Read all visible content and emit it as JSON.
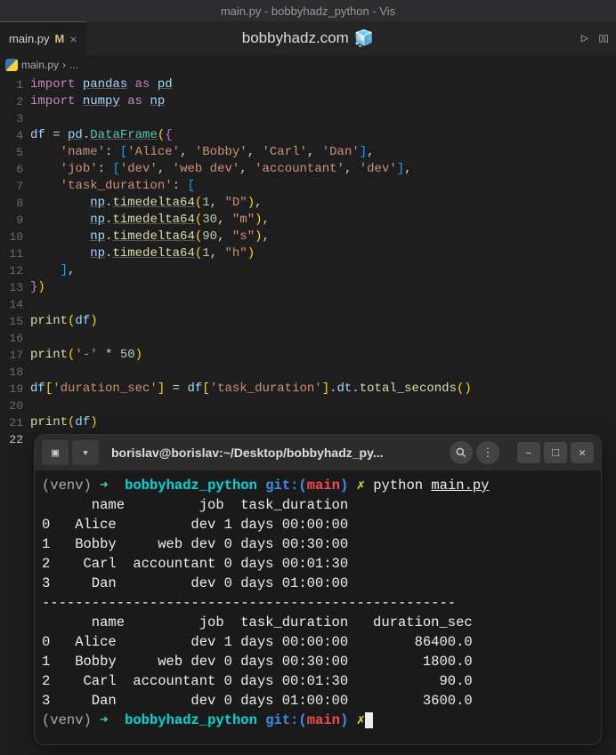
{
  "window": {
    "title": "main.py - bobbyhadz_python - Vis"
  },
  "tab": {
    "filename": "main.py",
    "modified": "M",
    "close": "×"
  },
  "banner": {
    "text": "bobbyhadz.com"
  },
  "breadcrumb": {
    "file": "main.py",
    "sep": "›",
    "more": "..."
  },
  "gutter_lines": [
    "1",
    "2",
    "3",
    "4",
    "5",
    "6",
    "7",
    "8",
    "9",
    "10",
    "11",
    "12",
    "13",
    "14",
    "15",
    "16",
    "17",
    "18",
    "19",
    "20",
    "21",
    "22"
  ],
  "code": {
    "l1_import": "import",
    "l1_pd": "pandas",
    "l1_as": "as",
    "l1_alias": "pd",
    "l2_np": "numpy",
    "l2_alias": "np",
    "l4_df": "df",
    "l4_eq": " = ",
    "l4_pd": "pd",
    "l4_DataFrame": "DataFrame",
    "l5_name": "'name'",
    "l5_alice": "'Alice'",
    "l5_bobby": "'Bobby'",
    "l5_carl": "'Carl'",
    "l5_dan": "'Dan'",
    "l6_job": "'job'",
    "l6_dev": "'dev'",
    "l6_webdev": "'web dev'",
    "l6_acc": "'accountant'",
    "l6_dev2": "'dev'",
    "l7_td": "'task_duration'",
    "l8_np": "np",
    "l8_fn": "timedelta64",
    "l8_n": "1",
    "l8_unit": "\"D\"",
    "l9_n": "30",
    "l9_unit": "\"m\"",
    "l10_n": "90",
    "l10_unit": "\"s\"",
    "l11_n": "1",
    "l11_unit": "\"h\"",
    "l15_print": "print",
    "l15_df": "df",
    "l17_dash": "'-'",
    "l17_mul": " * ",
    "l17_50": "50",
    "l19_df": "df",
    "l19_dur": "'duration_sec'",
    "l19_eq": " = ",
    "l19_td": "'task_duration'",
    "l19_dt": "dt",
    "l19_ts": "total_seconds"
  },
  "terminal": {
    "title": "borislav@borislav:~/Desktop/bobbyhadz_py...",
    "venv": "(venv)",
    "arrow": "➜",
    "dir": "bobbyhadz_python",
    "git": "git:(",
    "branch": "main",
    "git_close": ")",
    "prompt_sym": "✗",
    "cmd_python": "python",
    "cmd_file": "main.py",
    "out_header1": "      name         job  task_duration",
    "out_r0": "0   Alice         dev 1 days 00:00:00",
    "out_r1": "1   Bobby     web dev 0 days 00:30:00",
    "out_r2": "2    Carl  accountant 0 days 00:01:30",
    "out_r3": "3     Dan         dev 0 days 01:00:00",
    "out_sep": "--------------------------------------------------",
    "out_header2": "      name         job  task_duration   duration_sec",
    "out2_r0": "0   Alice         dev 1 days 00:00:00        86400.0",
    "out2_r1": "1   Bobby     web dev 0 days 00:30:00         1800.0",
    "out2_r2": "2    Carl  accountant 0 days 00:01:30           90.0",
    "out2_r3": "3     Dan         dev 0 days 01:00:00         3600.0"
  },
  "chart_data": {
    "type": "table",
    "title": "DataFrame output with task_duration converted to duration_sec",
    "columns": [
      "name",
      "job",
      "task_duration",
      "duration_sec"
    ],
    "rows": [
      {
        "name": "Alice",
        "job": "dev",
        "task_duration": "1 days 00:00:00",
        "duration_sec": 86400.0
      },
      {
        "name": "Bobby",
        "job": "web dev",
        "task_duration": "0 days 00:30:00",
        "duration_sec": 1800.0
      },
      {
        "name": "Carl",
        "job": "accountant",
        "task_duration": "0 days 00:01:30",
        "duration_sec": 90.0
      },
      {
        "name": "Dan",
        "job": "dev",
        "task_duration": "0 days 01:00:00",
        "duration_sec": 3600.0
      }
    ]
  }
}
